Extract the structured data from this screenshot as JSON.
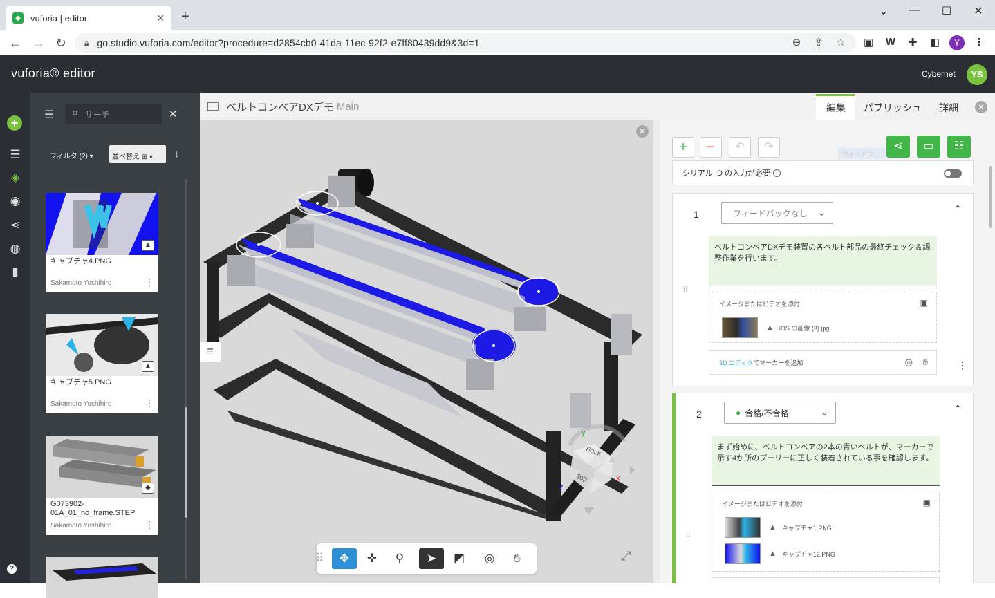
{
  "browser": {
    "tab_title": "vuforia | editor",
    "tab_close": "✕",
    "new_tab": "+",
    "url": "go.studio.vuforia.com/editor?procedure=d2854cb0-41da-11ec-92f2-e7ff80439dd9&3d=1",
    "ext_w": "W",
    "profile_initial": "Y"
  },
  "app": {
    "brand": "vuforia® editor",
    "user_name": "Cybernet",
    "user_initials": "YS"
  },
  "library": {
    "search_placeholder": "サーチ",
    "filter_label": "フィルタ (2)",
    "sort_label": "並べ替え",
    "items": [
      {
        "name": "キャプチャ4.PNG",
        "owner": "Sakamoto Yoshihiro",
        "kind": "image"
      },
      {
        "name": "キャプチャ5.PNG",
        "owner": "Sakamoto Yoshihiro",
        "kind": "image"
      },
      {
        "name": "G073902-01A_01_no_frame.STEP",
        "owner": "Sakamoto Yoshihiro",
        "kind": "model"
      }
    ]
  },
  "center": {
    "title": "ベルトコンベアDXデモ",
    "subtitle": "Main",
    "cube_labels": {
      "back": "Back",
      "top": "Top",
      "x": "x",
      "y": "y",
      "z": "z"
    }
  },
  "right": {
    "tabs": [
      "編集",
      "パブリッシュ",
      "詳細"
    ],
    "active_tab": "編集",
    "serial_label": "シリアル ID の入力が必要",
    "serial_enabled": false,
    "faded_text": "ウィンドウ",
    "steps": [
      {
        "number": "1",
        "feedback": "フィードバックなし",
        "description": "ベルトコンベアDXデモ装置の各ベルト部品の最終チェック＆調整作業を行います。",
        "media_header": "イメージまたはビデオを添付",
        "media": [
          "iOS の画像 (3).jpg"
        ],
        "marker_link": "3D エディタ",
        "marker_text": "でマーカーを追加"
      },
      {
        "number": "2",
        "feedback": "合格/不合格",
        "description": "まず始めに、ベルトコンベアの2本の青いベルトが、マーカーで示す4か所のプーリーに正しく装着されている事を確認します。",
        "media_header": "イメージまたはビデオを添付",
        "media": [
          "キャプチャ1.PNG",
          "キャプチャ12.PNG"
        ]
      }
    ]
  },
  "colors": {
    "accent_green": "#43b649",
    "header_dark": "#2b2f33",
    "belt_blue": "#1a1ae6"
  }
}
